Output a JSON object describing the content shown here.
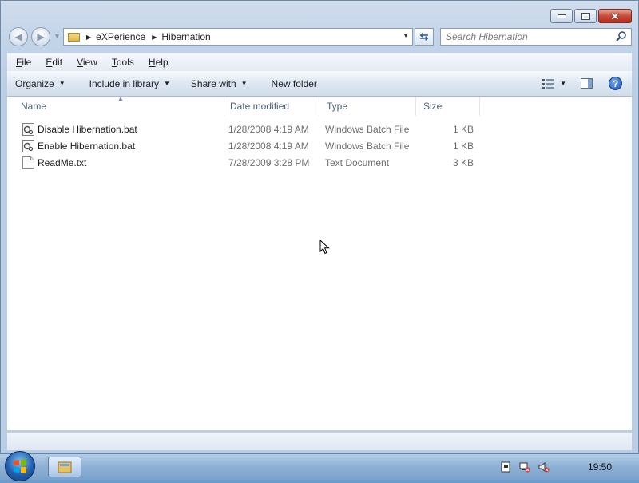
{
  "window": {
    "controls": {
      "minimize": "minimize",
      "maximize": "maximize",
      "close": "close"
    }
  },
  "address_bar": {
    "breadcrumbs": [
      "eXPerience",
      "Hibernation"
    ],
    "search_placeholder": "Search Hibernation"
  },
  "menu": {
    "items": [
      {
        "label": "File",
        "accel": "F",
        "rest": "ile"
      },
      {
        "label": "Edit",
        "accel": "E",
        "rest": "dit"
      },
      {
        "label": "View",
        "accel": "V",
        "rest": "iew"
      },
      {
        "label": "Tools",
        "accel": "T",
        "rest": "ools"
      },
      {
        "label": "Help",
        "accel": "H",
        "rest": "elp"
      }
    ]
  },
  "command_bar": {
    "organize": "Organize",
    "include_in_library": "Include in library",
    "share_with": "Share with",
    "new_folder": "New folder"
  },
  "file_list": {
    "columns": [
      "Name",
      "Date modified",
      "Type",
      "Size"
    ],
    "sorted_by": "Name",
    "rows": [
      {
        "name": "Disable Hibernation.bat",
        "date": "1/28/2008 4:19 AM",
        "type": "Windows Batch File",
        "size": "1 KB",
        "icon": "batch-file-icon"
      },
      {
        "name": "Enable Hibernation.bat",
        "date": "1/28/2008 4:19 AM",
        "type": "Windows Batch File",
        "size": "1 KB",
        "icon": "batch-file-icon"
      },
      {
        "name": "ReadMe.txt",
        "date": "7/28/2009 3:28 PM",
        "type": "Text Document",
        "size": "3 KB",
        "icon": "text-file-icon"
      }
    ]
  },
  "taskbar": {
    "clock": "19:50"
  },
  "colors": {
    "taskbar": "#8fb2d6",
    "window_frame": "#c1d3e8",
    "close_button": "#c74b37"
  }
}
